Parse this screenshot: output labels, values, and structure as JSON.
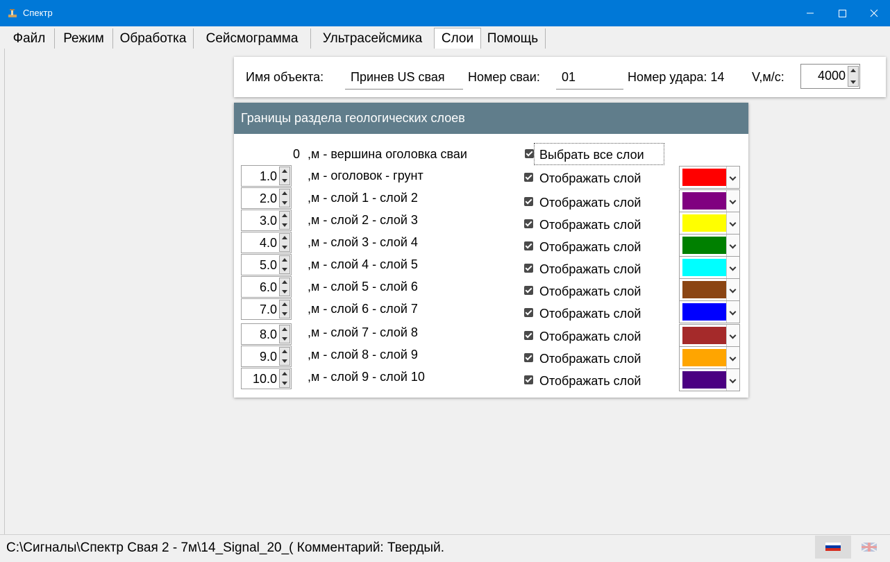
{
  "window": {
    "title": "Спектр"
  },
  "menu": [
    "Файл",
    "Режим",
    "Обработка",
    "Сейсмограмма",
    "Ультрасейсмика",
    "Слои",
    "Помощь"
  ],
  "header": {
    "object_label": "Имя объекта:",
    "object_value": "Принев US свая",
    "pile_label": "Номер сваи:",
    "pile_value": "01",
    "hit_label": "Номер удара: 14",
    "velocity_label": "V,м/с:",
    "velocity_value": "4000"
  },
  "layers": {
    "title": "Границы раздела геологических слоев",
    "top_value": "0",
    "top_label": ",м - вершина оголовка сваи",
    "select_all": "Выбрать все слои",
    "rows": [
      {
        "value": "1.0",
        "label": ",м - оголовок - грунт",
        "show": "Отображать слой",
        "color": "#ff0000"
      },
      {
        "value": "2.0",
        "label": ",м - слой 1 - слой 2",
        "show": "Отображать слой",
        "color": "#800080"
      },
      {
        "value": "3.0",
        "label": ",м - слой 2 - слой 3",
        "show": "Отображать слой",
        "color": "#ffff00"
      },
      {
        "value": "4.0",
        "label": ",м - слой 3 - слой 4",
        "show": "Отображать слой",
        "color": "#008000"
      },
      {
        "value": "5.0",
        "label": ",м - слой 4 - слой 5",
        "show": "Отображать слой",
        "color": "#00ffff"
      },
      {
        "value": "6.0",
        "label": ",м - слой 5 - слой 6",
        "show": "Отображать слой",
        "color": "#8b4513"
      },
      {
        "value": "7.0",
        "label": ",м - слой 6 - слой 7",
        "show": "Отображать слой",
        "color": "#0000ff"
      },
      {
        "value": "8.0",
        "label": ",м - слой 7 - слой 8",
        "show": "Отображать слой",
        "color": "#a52a2a"
      },
      {
        "value": "9.0",
        "label": ",м - слой 8 - слой 9",
        "show": "Отображать слой",
        "color": "#ffa500"
      },
      {
        "value": "10.0",
        "label": ",м - слой 9 - слой 10",
        "show": "Отображать слой",
        "color": "#4b0082"
      }
    ]
  },
  "status": {
    "text": "C:\\Сигналы\\Спектр Свая 2 - 7м\\14_Signal_20_( Комментарий: Твердый."
  }
}
